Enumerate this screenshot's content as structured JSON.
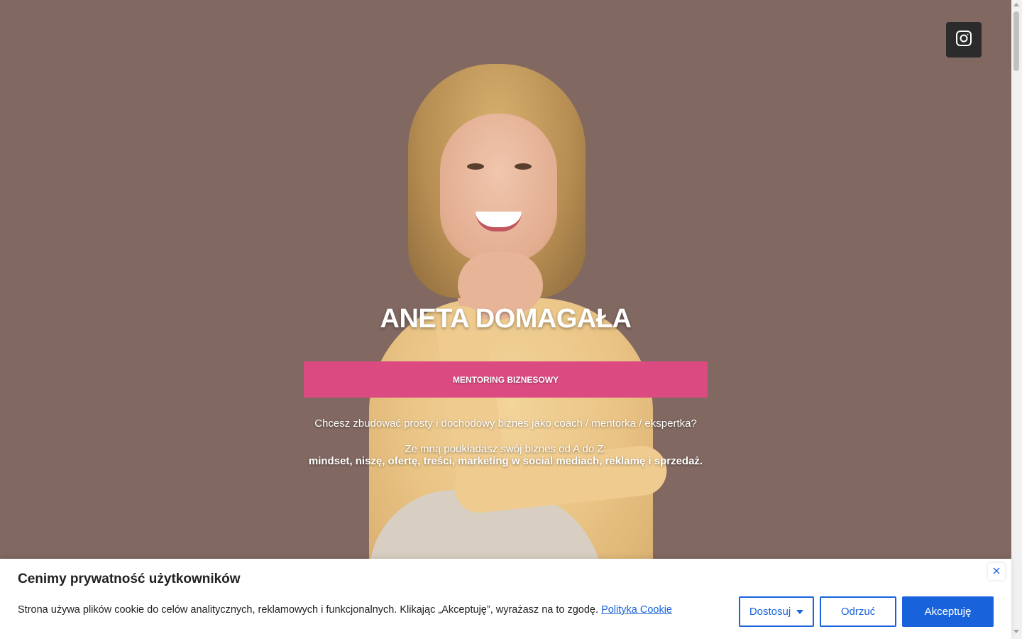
{
  "social": {
    "instagram_icon": "instagram-icon"
  },
  "hero": {
    "title": "ANETA DOMAGAŁA",
    "cta_label": "MENTORING BIZNESOWY",
    "intro": "Chcesz zbudować prosty i dochodowy biznes jako coach / mentorka / ekspertka?",
    "line2": "Ze mną poukładasz swój biznes od A do Z:",
    "line3": "mindset, niszę, ofertę, treści, marketing w social mediach, reklamę i sprzedaż."
  },
  "cookie": {
    "title": "Cenimy prywatność użytkowników",
    "text": "Strona używa plików cookie do celów analitycznych, reklamowych i funkcjonalnych. Klikając „Akceptuję”, wyrażasz na to zgodę.",
    "link_label": "Polityka Cookie",
    "customize_label": "Dostosuj",
    "reject_label": "Odrzuć",
    "accept_label": "Akceptuję"
  },
  "colors": {
    "background": "#816861",
    "cta": "#dc4a82",
    "accent_blue": "#1863dc"
  }
}
